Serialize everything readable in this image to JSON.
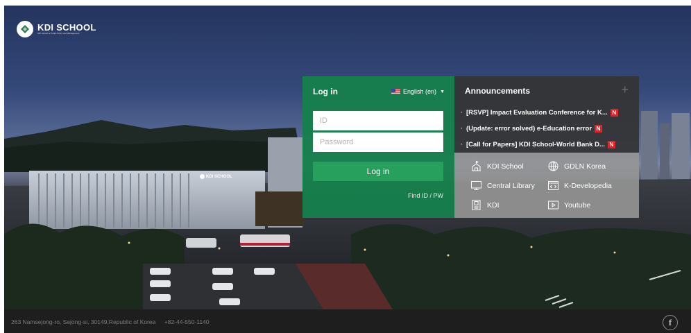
{
  "brand": {
    "name": "KDI SCHOOL",
    "tagline": "KDI School of Public Policy and Management",
    "building_sign": "KDI SCHOOL"
  },
  "login": {
    "title": "Log in",
    "language": "English (en)",
    "id_placeholder": "ID",
    "password_placeholder": "Password",
    "button": "Log in",
    "find_link": "Find ID / PW"
  },
  "announcements": {
    "title": "Announcements",
    "more_icon": "plus-icon",
    "new_badge": "N",
    "items": [
      {
        "text": "[RSVP] Impact Evaluation Conference for K..."
      },
      {
        "text": "(Update: error solved) e-Education error"
      },
      {
        "text": "[Call for Papers] KDI School-World Bank D..."
      }
    ]
  },
  "quick_links": [
    {
      "label": "KDI School",
      "icon": "school-building-icon"
    },
    {
      "label": "GDLN Korea",
      "icon": "globe-icon"
    },
    {
      "label": "Central Library",
      "icon": "monitor-icon"
    },
    {
      "label": "K-Developedia",
      "icon": "code-window-icon"
    },
    {
      "label": "KDI",
      "icon": "document-icon"
    },
    {
      "label": "Youtube",
      "icon": "play-icon"
    }
  ],
  "footer": {
    "address": "263 Namsejong-ro, Sejong-si, 30149,Republic of Korea",
    "phone": "+82-44-550-1140",
    "facebook_glyph": "f"
  },
  "colors": {
    "login_green": "#16804c",
    "button_green": "#27a05e",
    "announcement_bg": "#343434",
    "links_bg": "#969696",
    "new_badge": "#e2232a",
    "footer_bg": "#1e1e1e"
  }
}
